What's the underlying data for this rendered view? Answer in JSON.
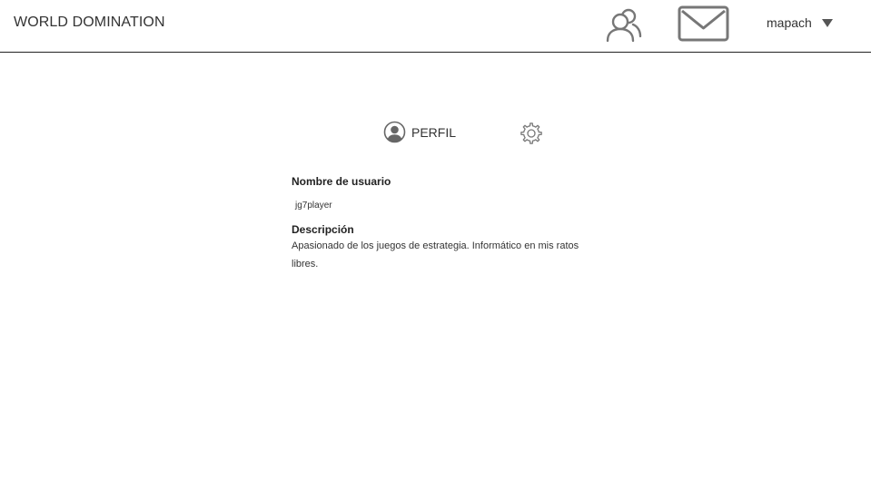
{
  "header": {
    "app_title": "WORLD DOMINATION",
    "friends_icon": "users-icon",
    "messages_icon": "envelope-icon",
    "user_menu": {
      "username": "mapach",
      "caret_icon": "caret-down-icon"
    }
  },
  "profile_tabs": {
    "profile": {
      "label": "PERFIL",
      "icon": "user-circle-icon"
    },
    "settings": {
      "icon": "gear-icon"
    }
  },
  "profile": {
    "username_label": "Nombre de usuario",
    "username_value": "jg7player",
    "description_label": "Descripción",
    "description_text": "Apasionado de los juegos de estrategia. Informático en mis ratos libres."
  },
  "colors": {
    "icon": "#777777",
    "text": "#333333",
    "divider": "#222222"
  }
}
